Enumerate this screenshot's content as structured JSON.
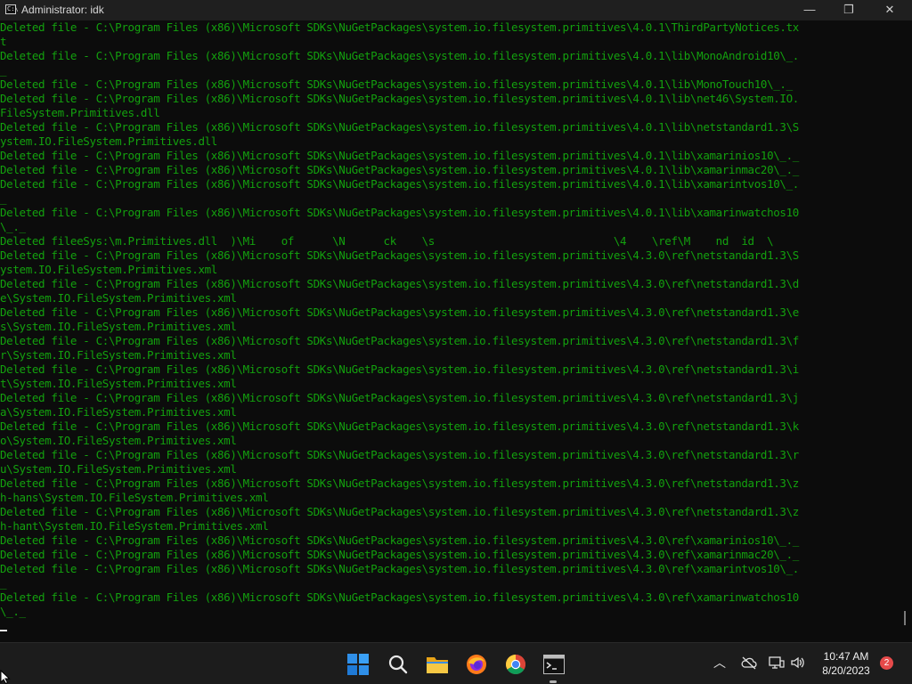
{
  "window": {
    "title": "Administrator:  idk",
    "icon": "cmd-icon",
    "minimize_glyph": "—",
    "maximize_glyph": "❐",
    "close_glyph": "✕"
  },
  "console": {
    "text_color": "#13a10e",
    "background": "#0c0c0c",
    "lines": [
      "Deleted file - C:\\Program Files (x86)\\Microsoft SDKs\\NuGetPackages\\system.io.filesystem.primitives\\4.0.1\\ThirdPartyNotices.tx",
      "t",
      "Deleted file - C:\\Program Files (x86)\\Microsoft SDKs\\NuGetPackages\\system.io.filesystem.primitives\\4.0.1\\lib\\MonoAndroid10\\_.",
      "_",
      "Deleted file - C:\\Program Files (x86)\\Microsoft SDKs\\NuGetPackages\\system.io.filesystem.primitives\\4.0.1\\lib\\MonoTouch10\\_._",
      "Deleted file - C:\\Program Files (x86)\\Microsoft SDKs\\NuGetPackages\\system.io.filesystem.primitives\\4.0.1\\lib\\net46\\System.IO.",
      "FileSystem.Primitives.dll",
      "Deleted file - C:\\Program Files (x86)\\Microsoft SDKs\\NuGetPackages\\system.io.filesystem.primitives\\4.0.1\\lib\\netstandard1.3\\S",
      "ystem.IO.FileSystem.Primitives.dll",
      "Deleted file - C:\\Program Files (x86)\\Microsoft SDKs\\NuGetPackages\\system.io.filesystem.primitives\\4.0.1\\lib\\xamarinios10\\_._",
      "Deleted file - C:\\Program Files (x86)\\Microsoft SDKs\\NuGetPackages\\system.io.filesystem.primitives\\4.0.1\\lib\\xamarinmac20\\_._",
      "Deleted file - C:\\Program Files (x86)\\Microsoft SDKs\\NuGetPackages\\system.io.filesystem.primitives\\4.0.1\\lib\\xamarintvos10\\_.",
      "_",
      "Deleted file - C:\\Program Files (x86)\\Microsoft SDKs\\NuGetPackages\\system.io.filesystem.primitives\\4.0.1\\lib\\xamarinwatchos10",
      "\\_._",
      "Deleted fileeSys:\\m.Primitives.dll  )\\Mi    of      \\N      ck    \\s                            \\4    \\ref\\M    nd  id  \\",
      "Deleted file - C:\\Program Files (x86)\\Microsoft SDKs\\NuGetPackages\\system.io.filesystem.primitives\\4.3.0\\ref\\netstandard1.3\\S",
      "ystem.IO.FileSystem.Primitives.xml",
      "Deleted file - C:\\Program Files (x86)\\Microsoft SDKs\\NuGetPackages\\system.io.filesystem.primitives\\4.3.0\\ref\\netstandard1.3\\d",
      "e\\System.IO.FileSystem.Primitives.xml",
      "Deleted file - C:\\Program Files (x86)\\Microsoft SDKs\\NuGetPackages\\system.io.filesystem.primitives\\4.3.0\\ref\\netstandard1.3\\e",
      "s\\System.IO.FileSystem.Primitives.xml",
      "Deleted file - C:\\Program Files (x86)\\Microsoft SDKs\\NuGetPackages\\system.io.filesystem.primitives\\4.3.0\\ref\\netstandard1.3\\f",
      "r\\System.IO.FileSystem.Primitives.xml",
      "Deleted file - C:\\Program Files (x86)\\Microsoft SDKs\\NuGetPackages\\system.io.filesystem.primitives\\4.3.0\\ref\\netstandard1.3\\i",
      "t\\System.IO.FileSystem.Primitives.xml",
      "Deleted file - C:\\Program Files (x86)\\Microsoft SDKs\\NuGetPackages\\system.io.filesystem.primitives\\4.3.0\\ref\\netstandard1.3\\j",
      "a\\System.IO.FileSystem.Primitives.xml",
      "Deleted file - C:\\Program Files (x86)\\Microsoft SDKs\\NuGetPackages\\system.io.filesystem.primitives\\4.3.0\\ref\\netstandard1.3\\k",
      "o\\System.IO.FileSystem.Primitives.xml",
      "Deleted file - C:\\Program Files (x86)\\Microsoft SDKs\\NuGetPackages\\system.io.filesystem.primitives\\4.3.0\\ref\\netstandard1.3\\r",
      "u\\System.IO.FileSystem.Primitives.xml",
      "Deleted file - C:\\Program Files (x86)\\Microsoft SDKs\\NuGetPackages\\system.io.filesystem.primitives\\4.3.0\\ref\\netstandard1.3\\z",
      "h-hans\\System.IO.FileSystem.Primitives.xml",
      "Deleted file - C:\\Program Files (x86)\\Microsoft SDKs\\NuGetPackages\\system.io.filesystem.primitives\\4.3.0\\ref\\netstandard1.3\\z",
      "h-hant\\System.IO.FileSystem.Primitives.xml",
      "Deleted file - C:\\Program Files (x86)\\Microsoft SDKs\\NuGetPackages\\system.io.filesystem.primitives\\4.3.0\\ref\\xamarinios10\\_._",
      "Deleted file - C:\\Program Files (x86)\\Microsoft SDKs\\NuGetPackages\\system.io.filesystem.primitives\\4.3.0\\ref\\xamarinmac20\\_._",
      "Deleted file - C:\\Program Files (x86)\\Microsoft SDKs\\NuGetPackages\\system.io.filesystem.primitives\\4.3.0\\ref\\xamarintvos10\\_.",
      "_",
      "Deleted file - C:\\Program Files (x86)\\Microsoft SDKs\\NuGetPackages\\system.io.filesystem.primitives\\4.3.0\\ref\\xamarinwatchos10",
      "\\_._"
    ]
  },
  "taskbar": {
    "apps": [
      {
        "name": "start",
        "icon": "windows-logo-icon"
      },
      {
        "name": "search",
        "icon": "search-icon"
      },
      {
        "name": "file-explorer",
        "icon": "folder-icon"
      },
      {
        "name": "firefox",
        "icon": "firefox-icon"
      },
      {
        "name": "chrome",
        "icon": "chrome-icon"
      },
      {
        "name": "command-prompt",
        "icon": "terminal-icon",
        "active": true
      }
    ],
    "tray": {
      "chevron_glyph": "︿",
      "icons": [
        "chevron-up-icon",
        "cloud-offline-icon",
        "network-icon",
        "volume-icon"
      ]
    },
    "clock": {
      "time": "10:47 AM",
      "date": "8/20/2023"
    },
    "notification_count": "2"
  }
}
